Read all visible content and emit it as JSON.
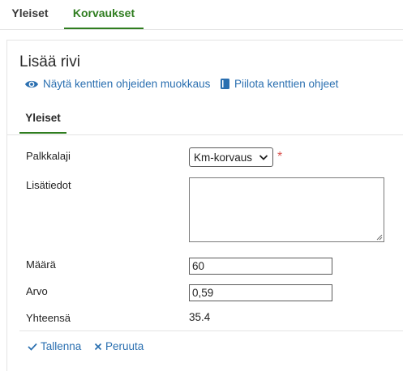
{
  "top_tabs": [
    {
      "label": "Yleiset",
      "active": false
    },
    {
      "label": "Korvaukset",
      "active": true
    }
  ],
  "panel": {
    "title": "Lisää rivi",
    "help_links": {
      "show_edit": "Näytä kenttien ohjeiden muokkaus",
      "hide_help": "Piilota kenttien ohjeet"
    },
    "inner_tab": "Yleiset",
    "fields": {
      "palkkalaji": {
        "label": "Palkkalaji",
        "value": "Km-korvaus",
        "required_mark": "*"
      },
      "lisatiedot": {
        "label": "Lisätiedot",
        "value": ""
      },
      "maara": {
        "label": "Määrä",
        "value": "60"
      },
      "arvo": {
        "label": "Arvo",
        "value": "0,59"
      },
      "yhteensa": {
        "label": "Yhteensä",
        "value": "35.4"
      }
    },
    "actions": {
      "save": "Tallenna",
      "cancel": "Peruuta"
    }
  },
  "colors": {
    "accent_green": "#2f7d1f",
    "link_blue": "#2a6fb0",
    "required_red": "#d9534f"
  },
  "icons": [
    "eye-icon",
    "book-icon",
    "chevron-down-icon",
    "check-icon",
    "close-icon"
  ]
}
